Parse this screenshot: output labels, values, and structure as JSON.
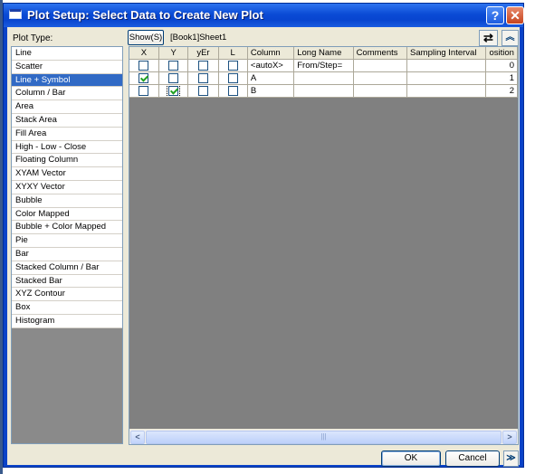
{
  "window": {
    "title": "Plot Setup: Select Data to Create New Plot",
    "help_label": "?",
    "close_label": "✕"
  },
  "plot_type": {
    "label": "Plot Type:",
    "selected": "Line + Symbol",
    "items": [
      "Line",
      "Scatter",
      "Line + Symbol",
      "Column / Bar",
      "Area",
      "Stack Area",
      "Fill Area",
      "High - Low - Close",
      "Floating Column",
      "XYAM Vector",
      "XYXY Vector",
      "Bubble",
      "Color Mapped",
      "Bubble + Color Mapped",
      "Pie",
      "Bar",
      "Stacked Column / Bar",
      "Stacked Bar",
      "XYZ Contour",
      "Box",
      "Histogram"
    ]
  },
  "toolbar": {
    "show_label": "Show(S)",
    "source": "[Book1]Sheet1",
    "swap_icon": "swap-arrows-icon",
    "collapse_icon": "double-chevron-up-icon"
  },
  "grid": {
    "headers": [
      "X",
      "Y",
      "yEr",
      "L",
      "Column",
      "Long Name",
      "Comments",
      "Sampling Interval",
      "osition"
    ],
    "rows": [
      {
        "x": false,
        "y": false,
        "yer": false,
        "l": false,
        "column": "<autoX>",
        "long_name": "From/Step=",
        "comments": "",
        "sampling": "",
        "position": "0"
      },
      {
        "x": true,
        "y": false,
        "yer": false,
        "l": false,
        "column": "A",
        "long_name": "",
        "comments": "",
        "sampling": "",
        "position": "1"
      },
      {
        "x": false,
        "y": true,
        "yer": false,
        "l": false,
        "column": "B",
        "long_name": "",
        "comments": "",
        "sampling": "",
        "position": "2"
      }
    ]
  },
  "scrollbar": {
    "left_arrow": "<",
    "right_arrow": ">",
    "grip": "|||"
  },
  "buttons": {
    "ok": "OK",
    "cancel": "Cancel",
    "more": "≫"
  },
  "colors": {
    "title_bar": "#0a4bd6",
    "selection": "#316ac5",
    "dialog_bg": "#ece9d8",
    "grid_empty": "#808080",
    "check_mark": "#21a121"
  }
}
